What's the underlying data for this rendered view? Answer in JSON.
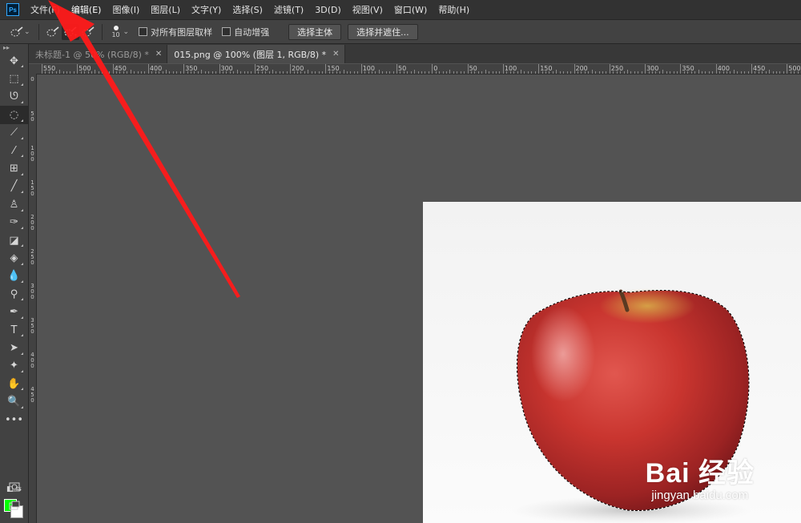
{
  "app": {
    "logo_text": "Ps",
    "accent": "#31a8ff"
  },
  "menu": [
    {
      "label": "文件(F)"
    },
    {
      "label": "编辑(E)"
    },
    {
      "label": "图像(I)"
    },
    {
      "label": "图层(L)"
    },
    {
      "label": "文字(Y)"
    },
    {
      "label": "选择(S)"
    },
    {
      "label": "滤镜(T)"
    },
    {
      "label": "3D(D)"
    },
    {
      "label": "视图(V)"
    },
    {
      "label": "窗口(W)"
    },
    {
      "label": "帮助(H)"
    }
  ],
  "options": {
    "brush_size": "10",
    "sample_all_layers": "对所有图层取样",
    "auto_enhance": "自动增强",
    "select_subject": "选择主体",
    "select_and_mask": "选择并遮住..."
  },
  "tabs": [
    {
      "label": "未标题-1 @ 50% (RGB/8) *",
      "active": false
    },
    {
      "label": "015.png @ 100% (图层 1, RGB/8) *",
      "active": true
    }
  ],
  "ruler_top_labels": [
    "550",
    "500",
    "450",
    "400",
    "350",
    "300",
    "250",
    "200",
    "150",
    "100",
    "50",
    "0",
    "50",
    "100",
    "150",
    "200",
    "250",
    "300",
    "350",
    "400",
    "450",
    "500"
  ],
  "ruler_left_labels": [
    "0",
    "5 0",
    "1 0 0",
    "1 5 0",
    "2 0 0",
    "2 5 0",
    "3 0 0",
    "3 5 0",
    "4 0 0",
    "4 5 0"
  ],
  "tools": [
    {
      "name": "move-tool",
      "icon": "✥"
    },
    {
      "name": "marquee-tool",
      "icon": "⬚"
    },
    {
      "name": "lasso-tool",
      "icon": "ᘎ"
    },
    {
      "name": "quick-selection-tool",
      "icon": "◌"
    },
    {
      "name": "crop-tool",
      "icon": "⟋"
    },
    {
      "name": "eyedropper-tool",
      "icon": "⁄"
    },
    {
      "name": "healing-brush-tool",
      "icon": "⊞"
    },
    {
      "name": "brush-tool",
      "icon": "╱"
    },
    {
      "name": "clone-stamp-tool",
      "icon": "♙"
    },
    {
      "name": "history-brush-tool",
      "icon": "✑"
    },
    {
      "name": "eraser-tool",
      "icon": "◪"
    },
    {
      "name": "paint-bucket-tool",
      "icon": "◈"
    },
    {
      "name": "blur-tool",
      "icon": "💧"
    },
    {
      "name": "dodge-tool",
      "icon": "⚲"
    },
    {
      "name": "pen-tool",
      "icon": "✒"
    },
    {
      "name": "type-tool",
      "icon": "T"
    },
    {
      "name": "path-selection-tool",
      "icon": "➤"
    },
    {
      "name": "custom-shape-tool",
      "icon": "✦"
    },
    {
      "name": "hand-tool",
      "icon": "✋"
    },
    {
      "name": "zoom-tool",
      "icon": "🔍"
    },
    {
      "name": "edit-toolbar",
      "icon": "•••"
    }
  ],
  "colors": {
    "foreground": "#00ff00",
    "background": "#ffffff"
  },
  "watermark": {
    "brand": "Bai 经验",
    "sub": "jingyan.baidu.com"
  }
}
